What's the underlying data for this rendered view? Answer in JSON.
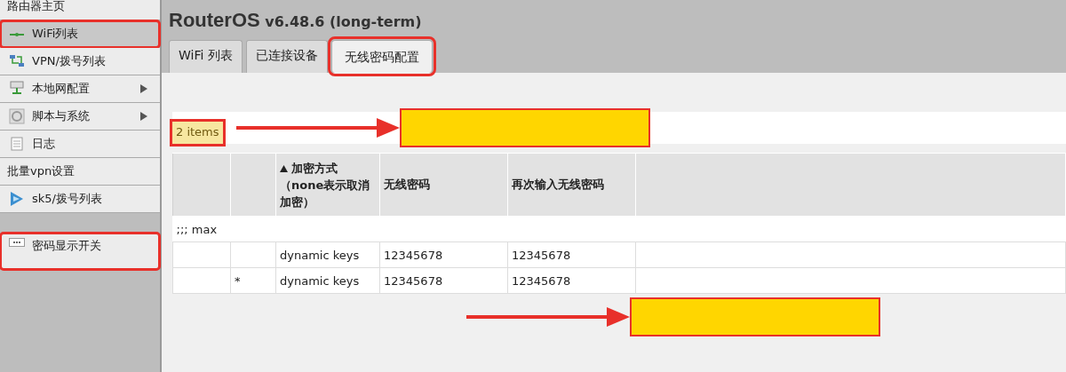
{
  "sidebar": {
    "items": [
      {
        "label": "路由器主页",
        "submenu": false,
        "selected": false,
        "highlighted": false,
        "separated": false
      },
      {
        "label": "WiFi列表",
        "submenu": false,
        "selected": true,
        "highlighted": true,
        "separated": false
      },
      {
        "label": "VPN/拨号列表",
        "submenu": false,
        "selected": false,
        "highlighted": false,
        "separated": false
      },
      {
        "label": "本地网配置",
        "submenu": true,
        "selected": false,
        "highlighted": false,
        "separated": false
      },
      {
        "label": "脚本与系统",
        "submenu": true,
        "selected": false,
        "highlighted": false,
        "separated": false
      },
      {
        "label": "日志",
        "submenu": false,
        "selected": false,
        "highlighted": false,
        "separated": false
      },
      {
        "label": "批量vpn设置",
        "submenu": false,
        "selected": false,
        "highlighted": false,
        "separated": false
      },
      {
        "label": "sk5/拨号列表",
        "submenu": false,
        "selected": false,
        "highlighted": false,
        "separated": false
      },
      {
        "label": "密码显示开关",
        "submenu": false,
        "selected": false,
        "highlighted": true,
        "separated": true
      }
    ]
  },
  "header": {
    "product": "RouterOS",
    "version": "v6.48.6 (long-term)"
  },
  "tabs": [
    {
      "label": "WiFi 列表",
      "selected": false,
      "highlighted": false
    },
    {
      "label": "已连接设备",
      "selected": false,
      "highlighted": false
    },
    {
      "label": "无线密码配置",
      "selected": true,
      "highlighted": true
    }
  ],
  "toolbar": {
    "count": "2 items",
    "highlighted": true,
    "callout": true
  },
  "table": {
    "columns": [
      {},
      {},
      {
        "label": "加密方式（none表示取消加密）",
        "sorted": true
      },
      {
        "label": "无线密码"
      },
      {
        "label": "再次输入无线密码"
      },
      {}
    ],
    "rows": [
      {
        "kind": "comment",
        "text": ";;; max"
      },
      {
        "kind": "data",
        "cells": [
          "",
          "",
          "dynamic keys",
          "12345678",
          "12345678",
          ""
        ]
      },
      {
        "kind": "data",
        "cells": [
          "",
          "*",
          "dynamic keys",
          "12345678",
          "12345678",
          ""
        ]
      }
    ]
  },
  "bottom_callout": true
}
